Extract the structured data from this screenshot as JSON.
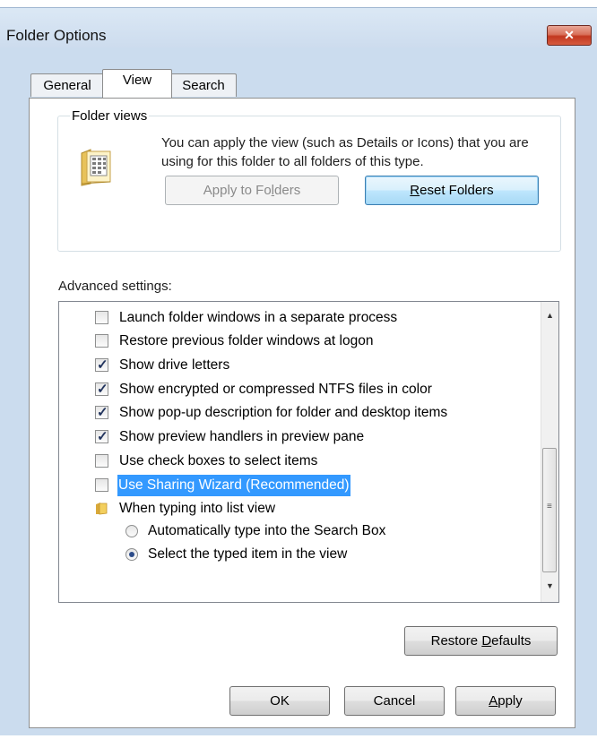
{
  "window": {
    "title": "Folder Options",
    "close_glyph": "✕"
  },
  "tabs": [
    {
      "label": "General",
      "active": false
    },
    {
      "label": "View",
      "active": true
    },
    {
      "label": "Search",
      "active": false
    }
  ],
  "folder_views": {
    "legend": "Folder views",
    "description": "You can apply the view (such as Details or Icons) that you are using for this folder to all folders of this type.",
    "apply_button": {
      "pre": "Apply to Fo",
      "accel": "l",
      "post": "ders",
      "enabled": false
    },
    "reset_button": {
      "pre": "",
      "accel": "R",
      "post": "eset Folders",
      "enabled": true
    },
    "icon": "folder-view-icon"
  },
  "advanced": {
    "label": "Advanced settings:",
    "items": [
      {
        "type": "checkbox",
        "checked": false,
        "label": "Launch folder windows in a separate process"
      },
      {
        "type": "checkbox",
        "checked": false,
        "label": "Restore previous folder windows at logon"
      },
      {
        "type": "checkbox",
        "checked": true,
        "label": "Show drive letters"
      },
      {
        "type": "checkbox",
        "checked": true,
        "label": "Show encrypted or compressed NTFS files in color"
      },
      {
        "type": "checkbox",
        "checked": true,
        "label": "Show pop-up description for folder and desktop items"
      },
      {
        "type": "checkbox",
        "checked": true,
        "label": "Show preview handlers in preview pane"
      },
      {
        "type": "checkbox",
        "checked": false,
        "label": "Use check boxes to select items"
      },
      {
        "type": "checkbox",
        "checked": false,
        "label": "Use Sharing Wizard (Recommended)",
        "selected": true
      },
      {
        "type": "folder",
        "label": "When typing into list view"
      },
      {
        "type": "radio",
        "checked": false,
        "label": "Automatically type into the Search Box"
      },
      {
        "type": "radio",
        "checked": true,
        "label": "Select the typed item in the view"
      }
    ]
  },
  "buttons": {
    "restore": {
      "pre": "Restore ",
      "accel": "D",
      "post": "efaults"
    },
    "ok": {
      "label": "OK"
    },
    "cancel": {
      "label": "Cancel"
    },
    "apply": {
      "pre": "",
      "accel": "A",
      "post": "pply"
    }
  },
  "colors": {
    "selection": "#3399ff",
    "frame": "#cbdcee",
    "close_button": "#c2371f"
  }
}
